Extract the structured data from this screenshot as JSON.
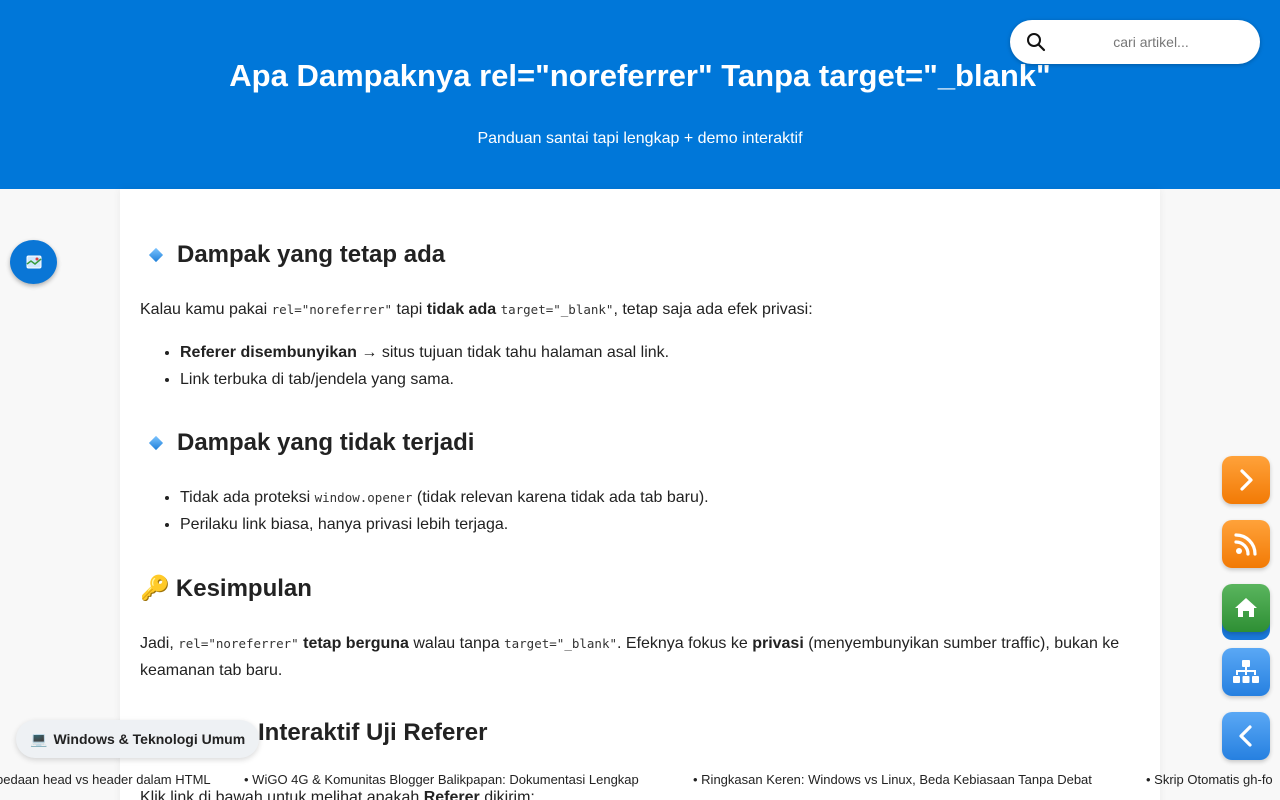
{
  "header": {
    "title": "Apa Dampaknya rel=\"noreferrer\" Tanpa target=\"_blank\"",
    "subtitle": "Panduan santai tapi lengkap + demo interaktif"
  },
  "search": {
    "placeholder": "cari artikel..."
  },
  "sections": [
    {
      "heading": "Dampak yang tetap ada",
      "intro": [
        "Kalau kamu pakai ",
        "rel=\"noreferrer\"",
        " tapi ",
        "tidak ada",
        " ",
        "target=\"_blank\"",
        ", tetap saja ada efek privasi:"
      ],
      "items": [
        [
          "Referer disembunyikan",
          " → situs tujuan tidak tahu halaman asal link."
        ],
        [
          "Link terbuka di tab/jendela yang sama."
        ]
      ]
    },
    {
      "heading": "Dampak yang tidak terjadi",
      "items": [
        [
          "Tidak ada proteksi ",
          "window.opener",
          " (tidak relevan karena tidak ada tab baru)."
        ],
        [
          "Perilaku link biasa, hanya privasi lebih terjaga."
        ]
      ]
    },
    {
      "heading": "Kesimpulan",
      "emoji": "🔑",
      "body": [
        "Jadi, ",
        "rel=\"noreferrer\"",
        " ",
        "tetap berguna",
        " walau tanpa ",
        "target=\"_blank\"",
        ". Efeknya fokus ke ",
        "privasi",
        " (menyembunyikan sumber traffic), bukan ke keamanan tab baru."
      ]
    },
    {
      "heading": "Interaktif Uji Referer",
      "body": [
        "Klik link di bawah untuk melihat apakah ",
        "Referer",
        " dikirim:"
      ]
    }
  ],
  "category_chip": {
    "icon": "💻",
    "label": "Windows & Teknologi Umum"
  },
  "ticker": [
    "bedaan head vs header dalam HTML",
    "WiGO 4G & Komunitas Blogger Balikpapan: Dokumentasi Lengkap",
    "Ringkasan Keren: Windows vs Linux, Beda Kebiasaan Tanpa Debat",
    "Skrip Otomatis gh-fo"
  ],
  "floating_buttons": [
    {
      "name": "next-icon",
      "color": "#f5860f"
    },
    {
      "name": "rss-icon",
      "color": "#f5860f"
    },
    {
      "name": "home-icon",
      "color": "#3a9c3f"
    },
    {
      "name": "sitemap-icon",
      "color": "#2f86e3"
    },
    {
      "name": "back-icon",
      "color": "#2f86e3"
    }
  ],
  "colors": {
    "header": "#0077d9",
    "accent": "#0a76d6"
  }
}
